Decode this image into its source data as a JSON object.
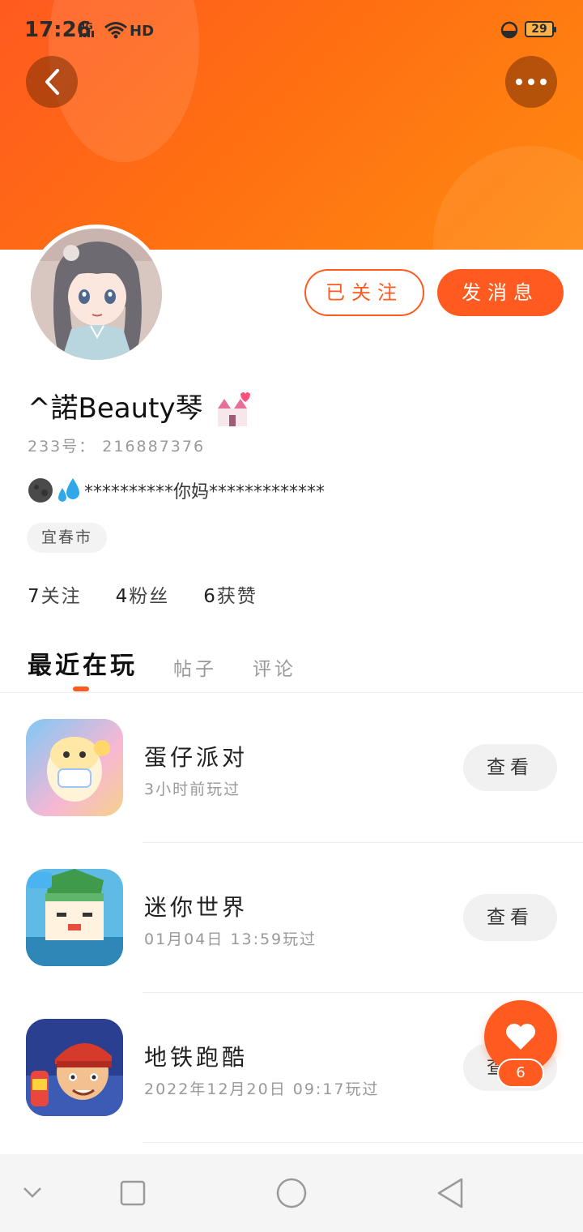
{
  "status_bar": {
    "time": "17:26",
    "network": "4G",
    "hd": "HD",
    "battery": "29"
  },
  "header": {
    "back_icon": "chevron-left-icon",
    "more_icon": "more-dots-icon",
    "accent": "#ff5a1f"
  },
  "profile": {
    "nickname": "^諾Beauty琴",
    "uid_label": "233号：",
    "uid": "216887376",
    "bio": "**********你妈*************",
    "location": "宜春市",
    "follow_button": "已关注",
    "message_button": "发消息"
  },
  "stats": {
    "following_count": "7",
    "following_label": "关注",
    "fans_count": "4",
    "fans_label": "粉丝",
    "likes_count": "6",
    "likes_label": "获赞"
  },
  "tabs": [
    {
      "label": "最近在玩",
      "active": true
    },
    {
      "label": "帖子",
      "active": false
    },
    {
      "label": "评论",
      "active": false
    }
  ],
  "games": [
    {
      "name": "蛋仔派对",
      "time": "3小时前玩过",
      "button": "查看"
    },
    {
      "name": "迷你世界",
      "time": "01月04日 13:59玩过",
      "button": "查看"
    },
    {
      "name": "地铁跑酷",
      "time": "2022年12月20日 09:17玩过",
      "button": "查看"
    }
  ],
  "like_fab": {
    "count": "6",
    "icon": "heart-icon"
  },
  "navbar": {
    "icons": [
      "chevron-down-icon",
      "square-icon",
      "circle-icon",
      "triangle-back-icon"
    ]
  }
}
